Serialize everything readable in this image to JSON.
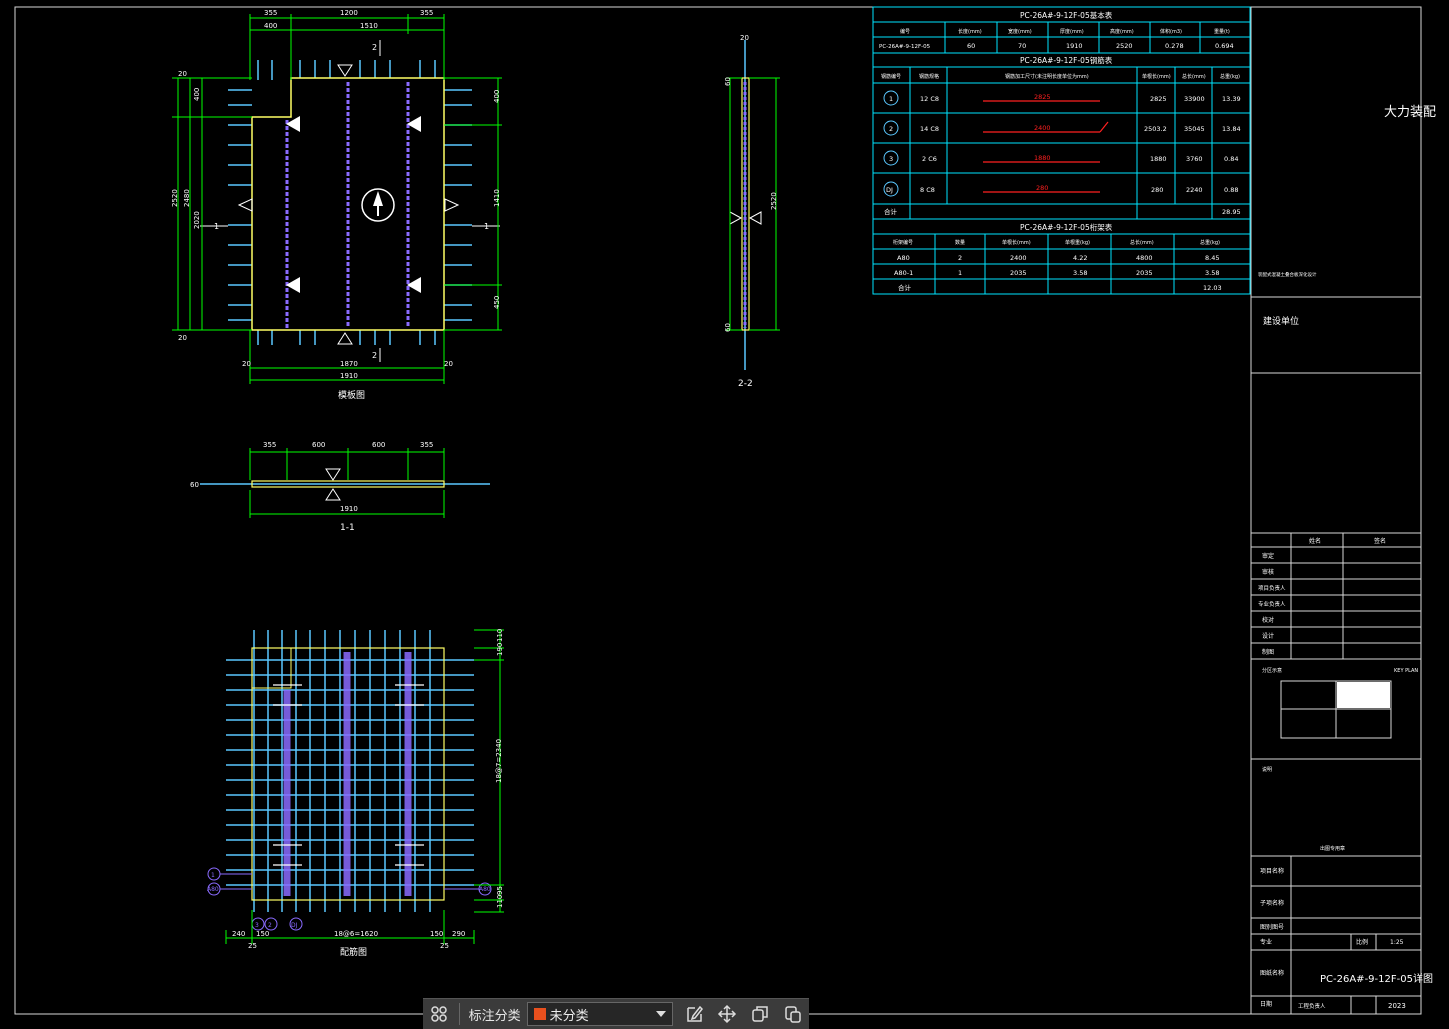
{
  "drawing": {
    "views": {
      "top": "模板图",
      "section1": "1-1",
      "section2": "2-2",
      "bottom": "配筋图"
    },
    "dims_top": [
      "355",
      "1200",
      "355",
      "400",
      "1510"
    ],
    "dims_top_bottom": [
      "20",
      "1870",
      "20",
      "1910"
    ],
    "dims_left": [
      "2520",
      "2480",
      "400",
      "2020",
      "20",
      "20"
    ],
    "dims_right": [
      "400",
      "1410",
      "450"
    ],
    "dims_sec1": [
      "355",
      "600",
      "600",
      "355",
      "1910",
      "60"
    ],
    "dims_sec2": [
      "20",
      "2520",
      "60",
      "60"
    ],
    "dims_bottom": [
      "240",
      "25",
      "150",
      "18@6=1620",
      "150",
      "290",
      "25",
      "110",
      "190",
      "18@7=2340",
      "95",
      "110"
    ],
    "section_marks": [
      "1",
      "1",
      "2",
      "2"
    ],
    "rebar_marks": [
      "1",
      "2",
      "3",
      "DJ",
      "A80"
    ]
  },
  "tables": {
    "basic": {
      "title": "PC-26A#-9-12F-05基本表",
      "headers": [
        "编号",
        "长度(mm)",
        "宽度(mm)",
        "厚度(mm)",
        "高度(mm)",
        "体积(m3)",
        "重量(t)"
      ],
      "row": [
        "PC-26A#-9-12F-05",
        "60",
        "70",
        "1910",
        "2520",
        "0.278",
        "0.694"
      ]
    },
    "rebar": {
      "title": "PC-26A#-9-12F-05钢筋表",
      "headers": [
        "钢筋编号",
        "钢筋规格",
        "钢筋加工尺寸(未注明长度单位为mm)",
        "单根长(mm)",
        "总长(mm)",
        "总重(kg)"
      ],
      "rows": [
        {
          "no": "1",
          "spec": "12 C8",
          "shape": "2825",
          "len": "2825",
          "total": "33900",
          "weight": "13.39"
        },
        {
          "no": "2",
          "spec": "14 C8",
          "shape": "2400",
          "len": "2503.2",
          "total": "35045",
          "weight": "13.84"
        },
        {
          "no": "3",
          "spec": "2 C6",
          "shape": "1880",
          "len": "1880",
          "total": "3760",
          "weight": "0.84"
        },
        {
          "no": "DJ",
          "spec": "8 C8",
          "shape": "280",
          "len": "280",
          "total": "2240",
          "weight": "0.88"
        }
      ],
      "total_label": "合计",
      "total": "28.95"
    },
    "truss": {
      "title": "PC-26A#-9-12F-05桁架表",
      "headers": [
        "桁架编号",
        "数量",
        "单根长(mm)",
        "单根重(kg)",
        "总长(mm)",
        "总重(kg)"
      ],
      "rows": [
        [
          "A80",
          "2",
          "2400",
          "4.22",
          "4800",
          "8.45"
        ],
        [
          "A80-1",
          "1",
          "2035",
          "3.58",
          "2035",
          "3.58"
        ]
      ],
      "total_label": "合计",
      "total": "12.03"
    }
  },
  "titleblock": {
    "project_title": "大力装配",
    "org_note": "装配式混凝土叠合板深化设计",
    "builder_label": "建设单位",
    "sign_headers": [
      "姓名",
      "签名"
    ],
    "roles": [
      "审定",
      "审核",
      "项目负责人",
      "专业负责人",
      "校对",
      "设计",
      "制图"
    ],
    "keyplan_label": "KEY PLAN",
    "keyplan_cn": "分区示意",
    "notes_label": "说明",
    "stamp_label": "出图专用章",
    "fields": [
      "项目名称",
      "子项名称",
      "图别图号",
      "专业",
      "图纸名称",
      "日期"
    ],
    "scale_label": "比例",
    "scale_value": "1:25",
    "sheet_title": "PC-26A#-9-12F-05详图",
    "date_value": "2023",
    "drawn_by_label": "工程负责人"
  },
  "toolbar": {
    "label": "标注分类",
    "selected": "未分类",
    "swatch_color": "#e8501e",
    "icons": [
      "grid-icon",
      "edit-icon",
      "move-icon",
      "copy-icon",
      "paste-icon"
    ]
  },
  "colors": {
    "background": "#000000",
    "table_line": "#00e5ff",
    "dimension": "#00ff00",
    "rebar": "#5bc8ff",
    "truss": "#8a6bff",
    "outline": "#ffff66",
    "shape": "#ff2020"
  }
}
